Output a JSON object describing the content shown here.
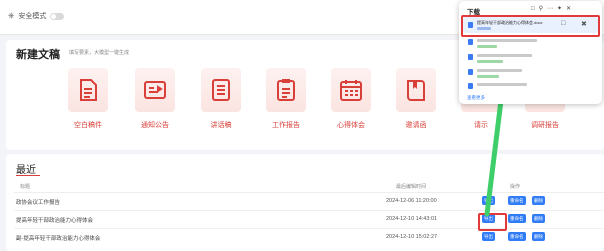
{
  "topbar": {
    "safe_mode_label": "安全模式"
  },
  "new_doc": {
    "title": "新建文稿",
    "subtitle": "填写要素，大模型一键生成",
    "templates": [
      {
        "label": "空白稿件",
        "icon": "document-icon"
      },
      {
        "label": "通知公告",
        "icon": "notice-card-icon"
      },
      {
        "label": "讲话稿",
        "icon": "speech-document-icon"
      },
      {
        "label": "工作报告",
        "icon": "report-document-icon"
      },
      {
        "label": "心得体会",
        "icon": "calendar-icon"
      },
      {
        "label": "邀请函",
        "icon": "invitation-book-icon"
      },
      {
        "label": "请示",
        "icon": "request-document-icon"
      },
      {
        "label": "调研报告",
        "icon": "research-report-icon"
      }
    ]
  },
  "recent": {
    "title": "最近",
    "headers": {
      "title": "标题",
      "modified": "最后编辑时间",
      "actions": "操作"
    },
    "rows": [
      {
        "title": "政协会议工作报告",
        "modified": "2024-12-06 11:20:00",
        "export": "导出",
        "rename": "重命名",
        "delete": "删除"
      },
      {
        "title": "提高年轻干部政治能力心得体会",
        "modified": "2024-12-10 14:43:01",
        "export": "导出",
        "rename": "重命名",
        "delete": "删除"
      },
      {
        "title": "副-提高年轻干部政治能力心得体会",
        "modified": "2024-12-10 15:02:27",
        "export": "导出",
        "rename": "重命名",
        "delete": "删除"
      }
    ]
  },
  "downloads": {
    "title": "下载",
    "first_file": "提高年轻干部政治能力心得体会.docx",
    "more_label": "查看更多"
  },
  "colors": {
    "accent": "#d9403a",
    "button": "#2f7cf6",
    "highlight": "#e23a3a",
    "arrow": "#3ecf6a"
  }
}
